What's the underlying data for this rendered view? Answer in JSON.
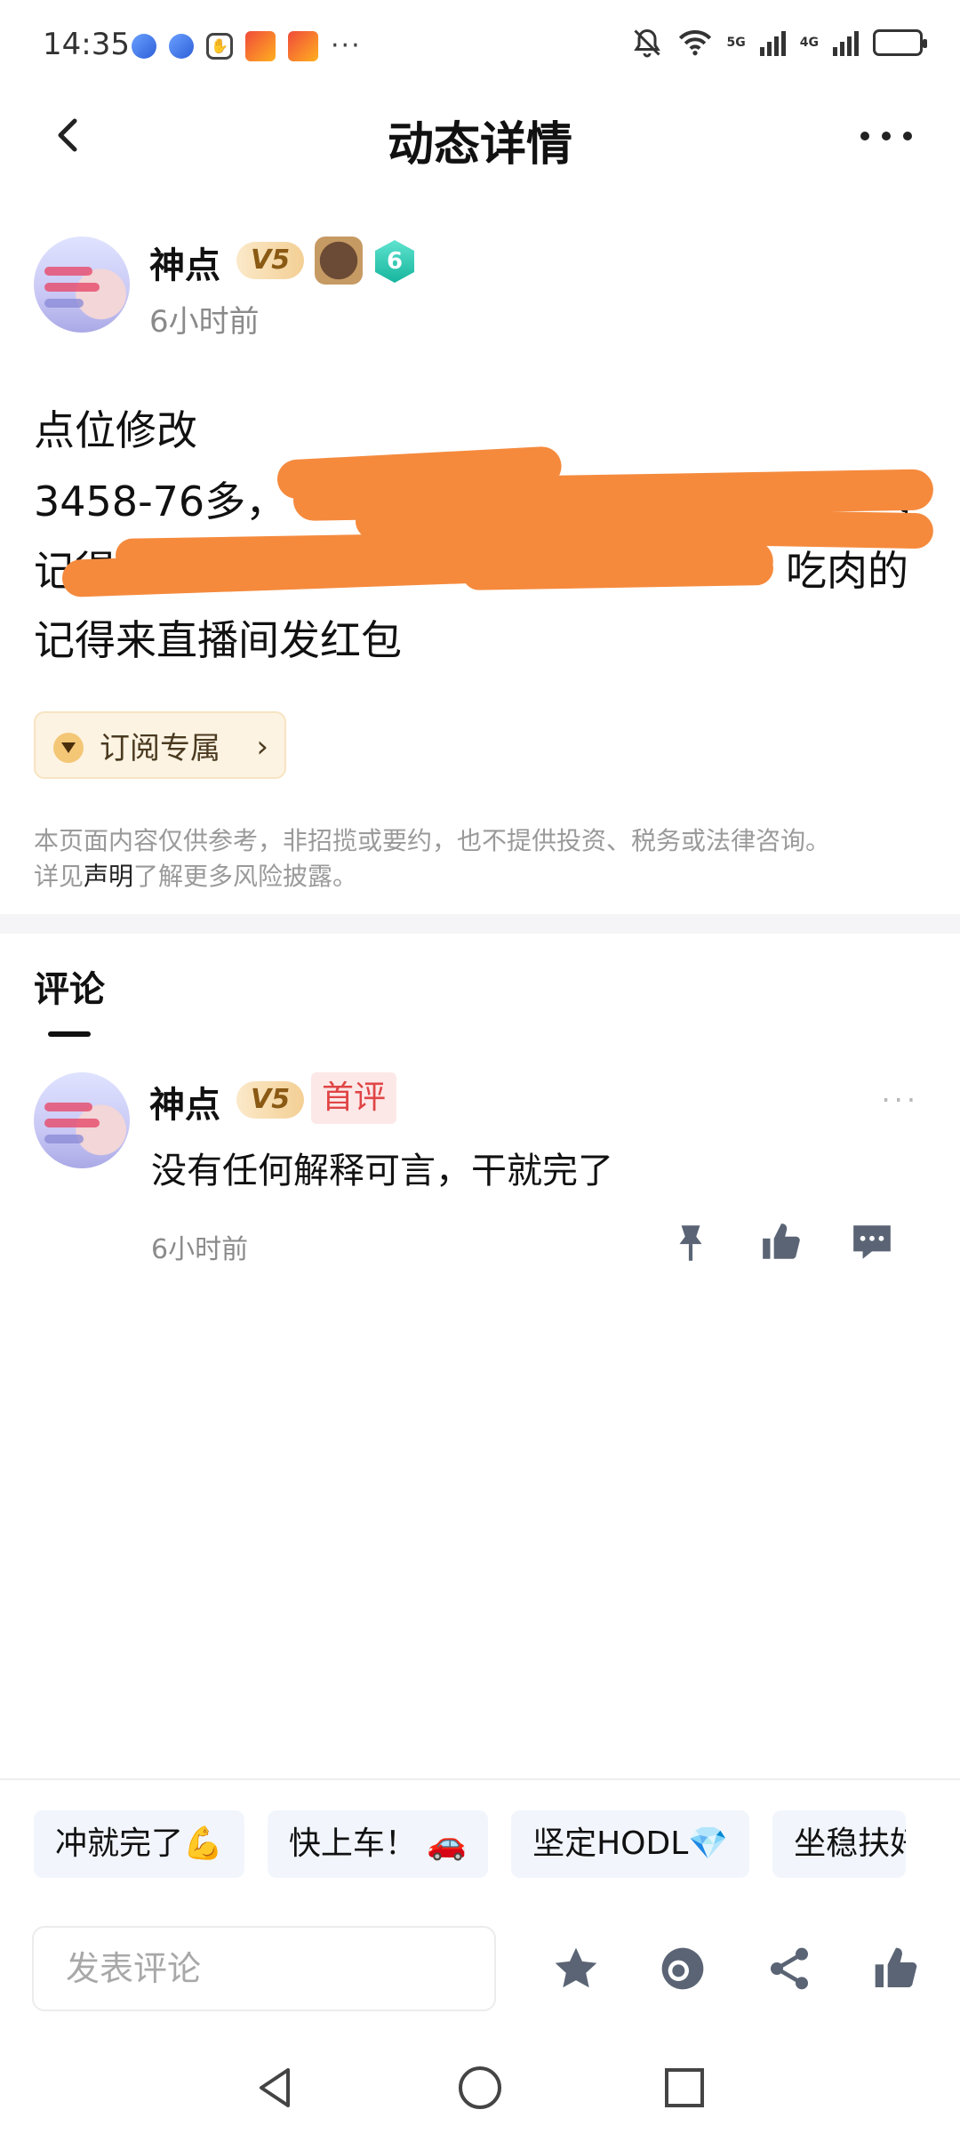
{
  "status_bar": {
    "time": "14:35",
    "more_indicator": "···",
    "network_1": "5G",
    "network_2": "4G",
    "icons": [
      "app-dot-icon",
      "app-dot-icon",
      "hand-hexagon-icon",
      "red-app-icon",
      "red-app-icon",
      "mute-bell-icon",
      "wifi-icon",
      "signal-icon",
      "signal-icon",
      "battery-icon"
    ]
  },
  "header": {
    "title": "动态详情",
    "back_icon": "chevron-left-icon",
    "more_icon": "more-dots-icon"
  },
  "post": {
    "author": {
      "name": "神点",
      "vip_level": "V5",
      "fan_level": "6"
    },
    "time": "6小时前",
    "title": "点位修改",
    "line_1": "3458-76多，",
    "line_1_end": "，",
    "line_2_start": "记得",
    "line_2_end": "吃肉的",
    "line_3": "记得来直播间发红包",
    "subscribe_label": "订阅专属",
    "disclaimer_1": "本页面内容仅供参考，非招揽或要约，也不提供投资、税务或法律咨询。",
    "disclaimer_2_pre": "详见",
    "disclaimer_link": "声明",
    "disclaimer_2_post": "了解更多风险披露。"
  },
  "comments": {
    "section_title": "评论",
    "items": [
      {
        "author": "神点",
        "vip_level": "V5",
        "badge": "首评",
        "text": "没有任何解释可言，干就完了",
        "time": "6小时前",
        "more": "···"
      }
    ]
  },
  "quick_replies": [
    "冲就完了💪",
    "快上车！ 🚗",
    "坚定HODL💎",
    "坐稳扶好"
  ],
  "composer": {
    "placeholder": "发表评论",
    "actions": [
      "star-icon",
      "reward-coin-icon",
      "share-icon",
      "thumbs-up-icon"
    ]
  },
  "nav": {
    "icons": [
      "back-triangle-icon",
      "home-circle-icon",
      "recents-square-icon"
    ]
  },
  "colors": {
    "redaction": "#f58a3d",
    "vip_badge": "#f3cf94",
    "first_comment_badge": "#e04545",
    "chip_bg": "#f2f6fc"
  }
}
